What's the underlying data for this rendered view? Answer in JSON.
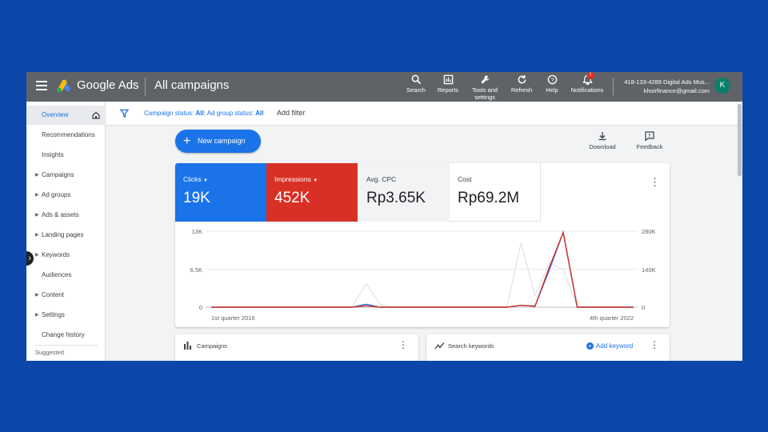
{
  "header": {
    "brand": "Google Ads",
    "page_title": "All campaigns",
    "toolbar": [
      {
        "label": "Search",
        "icon": "search-icon"
      },
      {
        "label": "Reports",
        "icon": "reports-icon"
      },
      {
        "label": "Tools and settings",
        "icon": "wrench-icon"
      },
      {
        "label": "Refresh",
        "icon": "refresh-icon"
      },
      {
        "label": "Help",
        "icon": "help-icon"
      },
      {
        "label": "Notifications",
        "icon": "bell-icon",
        "badge": "!"
      }
    ],
    "account_line1": "418-133-4289 Digital Ads Mus...",
    "account_line2": "khoirfinance@gmail.com",
    "avatar_letter": "K"
  },
  "sidebar": {
    "items": [
      {
        "label": "Overview",
        "active": true,
        "caret": false
      },
      {
        "label": "Recommendations",
        "caret": false
      },
      {
        "label": "Insights",
        "caret": false
      },
      {
        "label": "Campaigns",
        "caret": true
      },
      {
        "label": "Ad groups",
        "caret": true
      },
      {
        "label": "Ads & assets",
        "caret": true
      },
      {
        "label": "Landing pages",
        "caret": true
      },
      {
        "label": "Keywords",
        "caret": true
      },
      {
        "label": "Audiences",
        "caret": false
      },
      {
        "label": "Content",
        "caret": true
      },
      {
        "label": "Settings",
        "caret": true
      },
      {
        "label": "Change history",
        "caret": false
      }
    ],
    "suggested": "Suggested"
  },
  "filterbar": {
    "status_prefix": "Campaign status: ",
    "status_value": "All",
    "group_prefix": "; Ad group status: ",
    "group_value": "All",
    "add_filter": "Add filter"
  },
  "main": {
    "new_campaign": "New campaign",
    "download": "Download",
    "feedback": "Feedback"
  },
  "metrics": {
    "clicks": {
      "label": "Clicks",
      "value": "19K"
    },
    "impressions": {
      "label": "Impressions",
      "value": "452K"
    },
    "cpc": {
      "label": "Avg. CPC",
      "value": "Rp3.65K"
    },
    "cost": {
      "label": "Cost",
      "value": "Rp69.2M"
    }
  },
  "cards": {
    "campaigns": "Campaigns",
    "search_keywords": "Search keywords",
    "add_keyword": "Add keyword"
  },
  "colors": {
    "clicks": "#1a73e8",
    "impressions": "#d93025",
    "other": "#dadce0"
  },
  "chart_data": {
    "type": "line",
    "left_ticks": [
      "13K",
      "6.5K",
      "0"
    ],
    "right_ticks": [
      "280K",
      "140K",
      "0"
    ],
    "x_start_label": "1st quarter 2016",
    "x_end_label": "4th quarter 2022",
    "left_range": [
      0,
      13000
    ],
    "right_range": [
      0,
      280000
    ],
    "series": [
      {
        "key": "other",
        "axis": "left",
        "values": [
          0,
          0,
          0,
          0,
          0,
          0,
          0,
          0,
          0,
          0,
          0,
          4000,
          500,
          0,
          0,
          0,
          0,
          0,
          0,
          0,
          0,
          0,
          11000,
          2000,
          7500,
          6500,
          0,
          0,
          0,
          0,
          0
        ]
      },
      {
        "key": "clicks",
        "axis": "left",
        "values": [
          0,
          0,
          0,
          0,
          0,
          0,
          0,
          0,
          0,
          0,
          0,
          500,
          0,
          0,
          0,
          0,
          0,
          0,
          0,
          0,
          0,
          0,
          300,
          200,
          6300,
          12800,
          0,
          0,
          0,
          0,
          0
        ]
      },
      {
        "key": "impressions",
        "axis": "right",
        "values": [
          0,
          0,
          0,
          0,
          0,
          0,
          0,
          0,
          0,
          0,
          0,
          5000,
          0,
          0,
          0,
          0,
          0,
          0,
          0,
          0,
          0,
          0,
          7000,
          3000,
          145000,
          275000,
          0,
          0,
          0,
          0,
          0
        ]
      }
    ]
  }
}
